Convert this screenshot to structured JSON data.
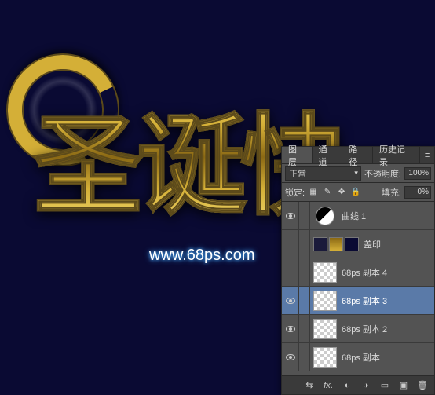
{
  "artwork": {
    "text": "圣诞快",
    "watermark": "www.68ps.com"
  },
  "panel": {
    "tabs": [
      "图层",
      "通道",
      "路径",
      "历史记录"
    ],
    "active_tab": 0,
    "blend_mode": "正常",
    "opacity_label": "不透明度:",
    "opacity_value": "100%",
    "lock_label": "锁定:",
    "fill_label": "填充:",
    "fill_value": "0%",
    "layers": [
      {
        "name": "曲线 1",
        "visible": true,
        "type": "adjustment",
        "selected": false
      },
      {
        "name": "盖印",
        "visible": false,
        "type": "stamp",
        "selected": false
      },
      {
        "name": "68ps 副本 4",
        "visible": false,
        "type": "normal",
        "selected": false
      },
      {
        "name": "68ps 副本 3",
        "visible": true,
        "type": "normal",
        "selected": true
      },
      {
        "name": "68ps 副本 2",
        "visible": true,
        "type": "normal",
        "selected": false
      },
      {
        "name": "68ps 副本",
        "visible": true,
        "type": "normal",
        "selected": false
      }
    ],
    "footer_icons": [
      "link",
      "fx",
      "mask",
      "adjust",
      "folder",
      "new",
      "trash"
    ]
  }
}
